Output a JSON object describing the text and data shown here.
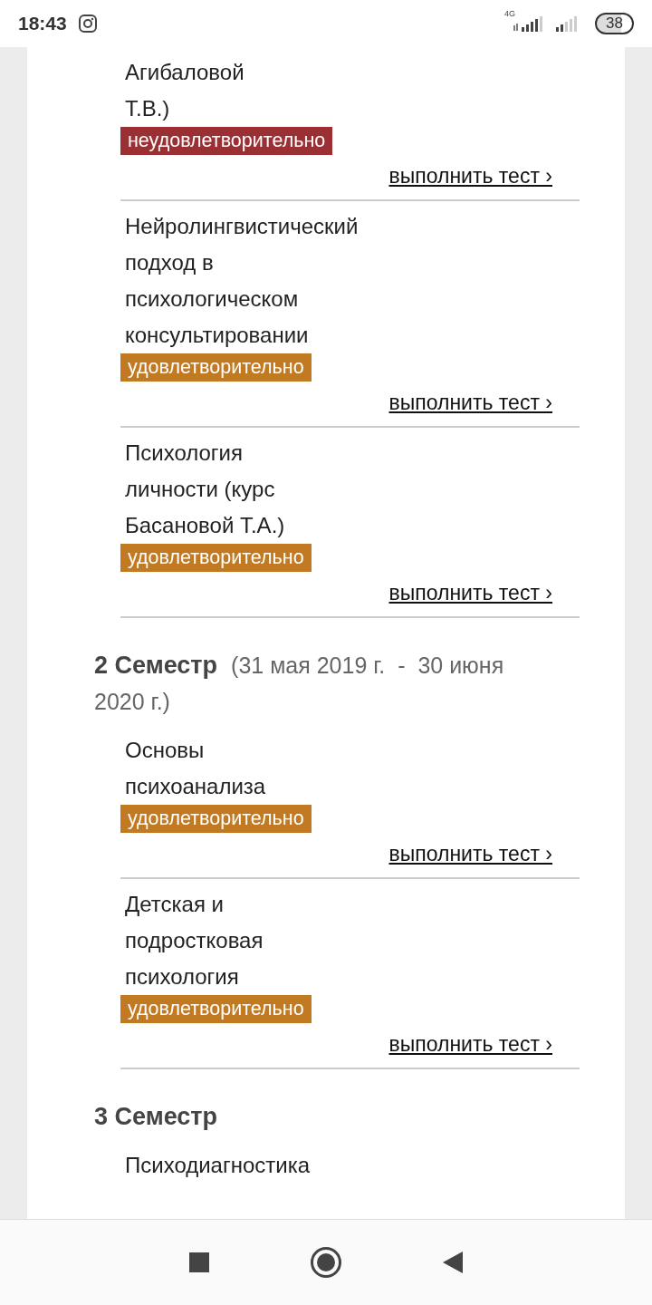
{
  "status_bar": {
    "time": "18:43",
    "network": "4G",
    "battery": "38"
  },
  "sections": [
    {
      "courses": [
        {
          "title_lines": [
            "Агибаловой",
            "Т.В.)"
          ],
          "grade": "неудовлетворительно",
          "passed": false,
          "action": "выполнить тест ›"
        },
        {
          "title_lines": [
            "Нейролингвистический",
            "подход в",
            "психологическом",
            "консультировании"
          ],
          "grade": "удовлетворительно",
          "passed": true,
          "action": "выполнить тест ›"
        },
        {
          "title_lines": [
            "Психология",
            "личности (курс",
            "Басановой Т.А.)"
          ],
          "grade": "удовлетворительно",
          "passed": true,
          "action": "выполнить тест ›"
        }
      ]
    },
    {
      "title": "2 Семестр",
      "dates": "(31 мая 2019 г.  -  30 июня 2020 г.)",
      "courses": [
        {
          "title_lines": [
            "Основы",
            "психоанализа"
          ],
          "grade": "удовлетворительно",
          "passed": true,
          "action": "выполнить тест ›"
        },
        {
          "title_lines": [
            "Детская и",
            "подростковая",
            "психология"
          ],
          "grade": "удовлетворительно",
          "passed": true,
          "action": "выполнить тест ›"
        }
      ]
    },
    {
      "title": "3 Семестр",
      "courses": [
        {
          "title_lines": [
            "Психодиагностика"
          ]
        }
      ]
    }
  ]
}
